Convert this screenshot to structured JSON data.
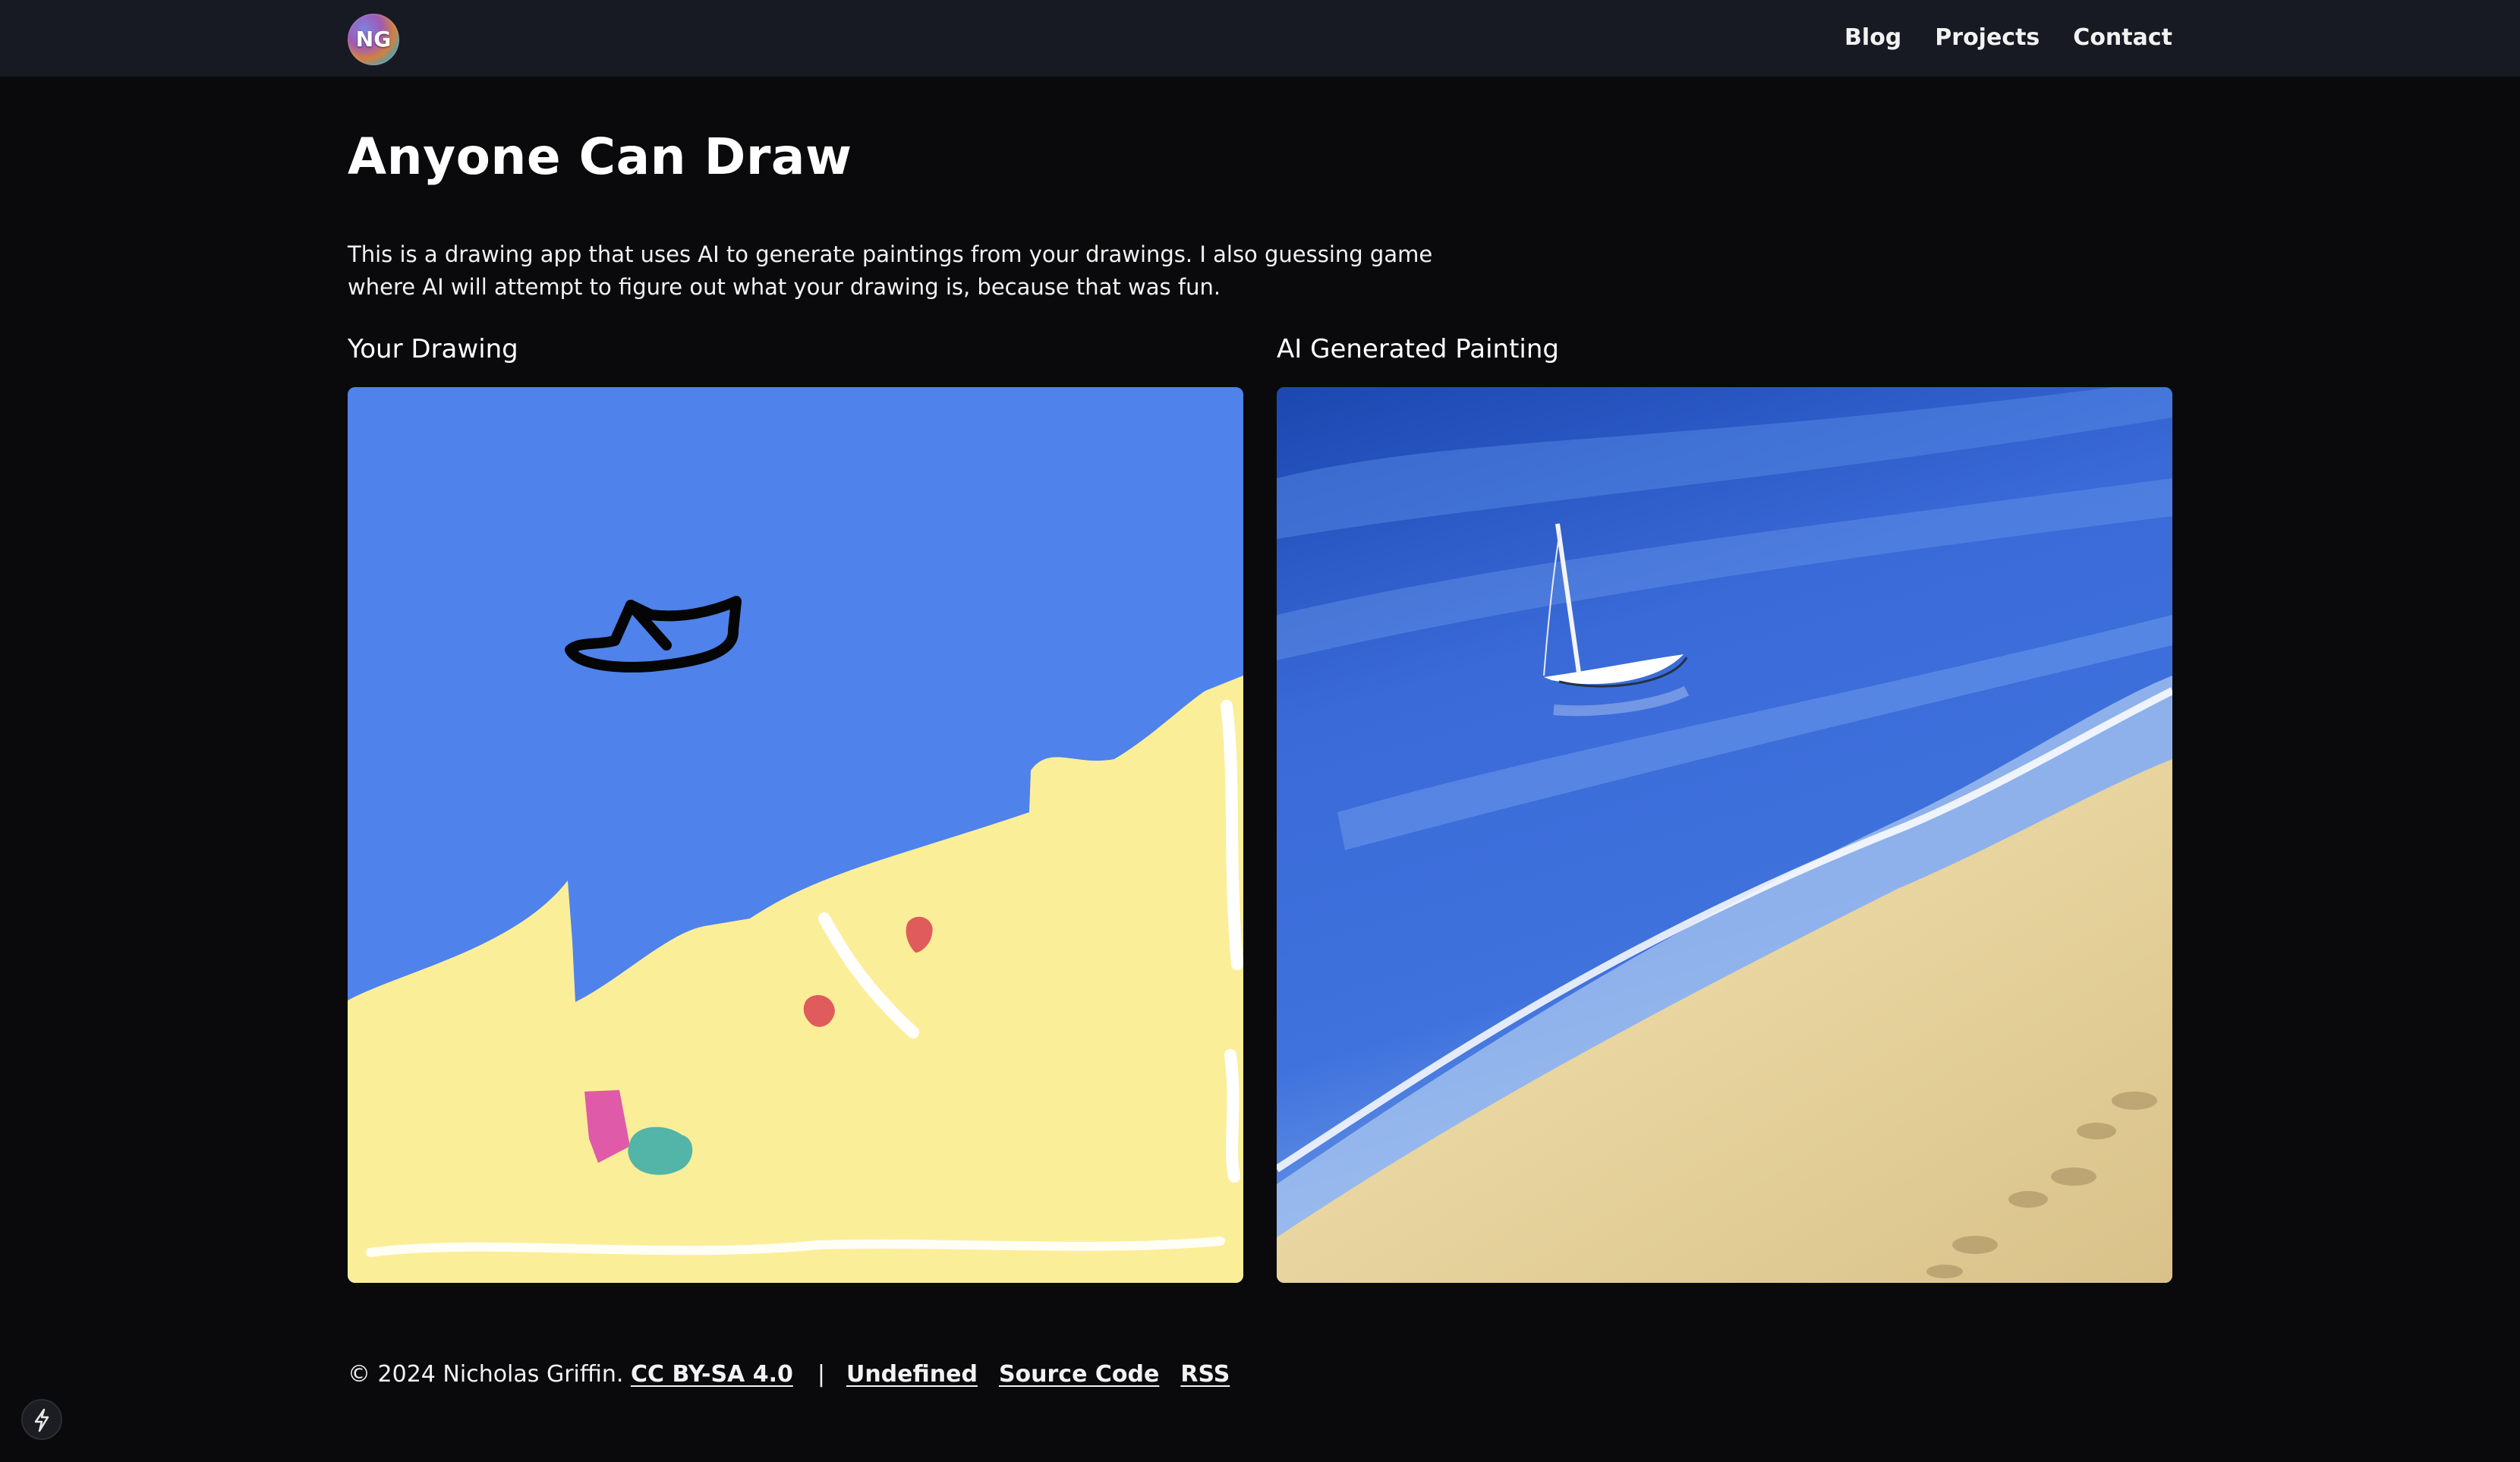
{
  "header": {
    "logo_initials": "NG",
    "nav": [
      {
        "label": "Blog"
      },
      {
        "label": "Projects"
      },
      {
        "label": "Contact"
      }
    ]
  },
  "main": {
    "title": "Anyone Can Draw",
    "intro": "This is a drawing app that uses AI to generate paintings from your drawings. I also guessing game where AI will attempt to figure out what your drawing is, because that was fun.",
    "drawing_label": "Your Drawing",
    "painting_label": "AI Generated Painting"
  },
  "footer": {
    "copyright": "© 2024 Nicholas Griffin.",
    "license_link": "CC BY-SA 4.0",
    "separator": "|",
    "links": [
      {
        "label": "Undefined"
      },
      {
        "label": "Source Code"
      },
      {
        "label": "RSS"
      }
    ]
  },
  "colors": {
    "background": "#0a0a0c",
    "topbar": "#171a22",
    "drawing_sky": "#4f82ea",
    "drawing_sand": "#fbee98",
    "painting_water": "#2a58c8",
    "painting_sand": "#e4cf96"
  },
  "icons": {
    "bolt": "lightning-bolt-icon"
  }
}
